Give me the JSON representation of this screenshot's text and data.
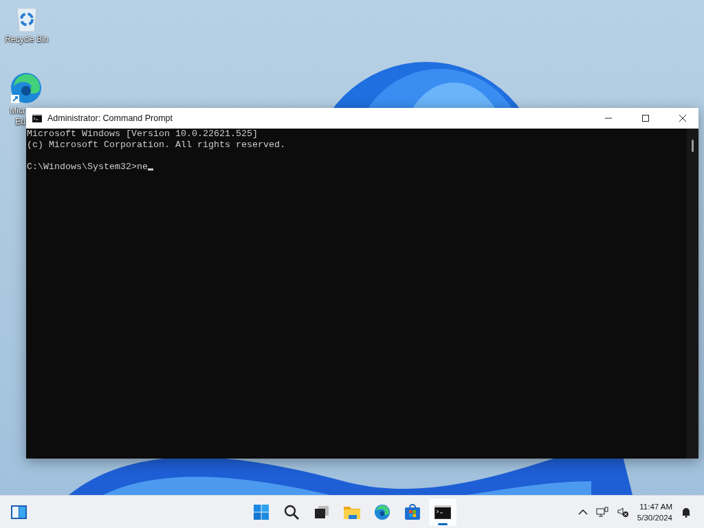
{
  "desktop_icons": [
    {
      "kind": "recycle-bin",
      "label_lines": [
        "Recycle Bin"
      ]
    },
    {
      "kind": "edge",
      "label_lines": [
        "Micr",
        "Ed"
      ]
    }
  ],
  "window": {
    "title": "Administrator: Command Prompt",
    "console": {
      "output_lines": [
        "Microsoft Windows [Version 10.0.22621.525]",
        "(c) Microsoft Corporation. All rights reserved."
      ],
      "prompt": "C:\\Windows\\System32>",
      "input": "ne",
      "cursor": true
    }
  },
  "taskbar": {
    "apps": [
      {
        "kind": "start",
        "active": false
      },
      {
        "kind": "search",
        "active": false
      },
      {
        "kind": "task-view",
        "active": false
      },
      {
        "kind": "explorer",
        "active": false
      },
      {
        "kind": "edge",
        "active": false
      },
      {
        "kind": "store",
        "active": false
      },
      {
        "kind": "terminal",
        "active": true
      }
    ],
    "clock": {
      "time": "11:47 AM",
      "date": "5/30/2024"
    }
  }
}
